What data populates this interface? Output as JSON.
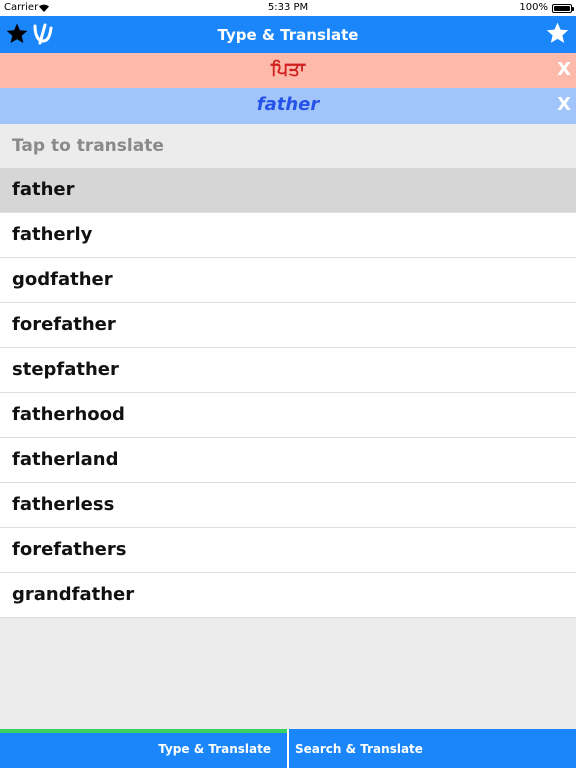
{
  "status_bar": {
    "carrier": "Carrier",
    "time": "5:33 PM",
    "battery": "100%"
  },
  "nav": {
    "title": "Type & Translate",
    "favorites_icon": "star-icon",
    "logo_icon": "app-logo-icon",
    "add_favorite_icon": "star-icon"
  },
  "translation": {
    "text": "ਪਿਤਾ",
    "close": "X"
  },
  "input": {
    "text": "father",
    "close": "X"
  },
  "hint": "Tap to translate",
  "suggestions": [
    "father",
    "fatherly",
    "godfather",
    "forefather",
    "stepfather",
    "fatherhood",
    "fatherland",
    "fatherless",
    "forefathers",
    "grandfather"
  ],
  "tabs": [
    {
      "label": "Type & Translate",
      "active": true
    },
    {
      "label": "Search & Translate",
      "active": false
    }
  ],
  "colors": {
    "nav_blue": "#1a86f9",
    "translation_bg": "#fdb9aa",
    "translation_text": "#d02020",
    "input_bg": "#a1c5fa",
    "input_text": "#2552e8",
    "active_tab_indicator": "#37d35e"
  }
}
